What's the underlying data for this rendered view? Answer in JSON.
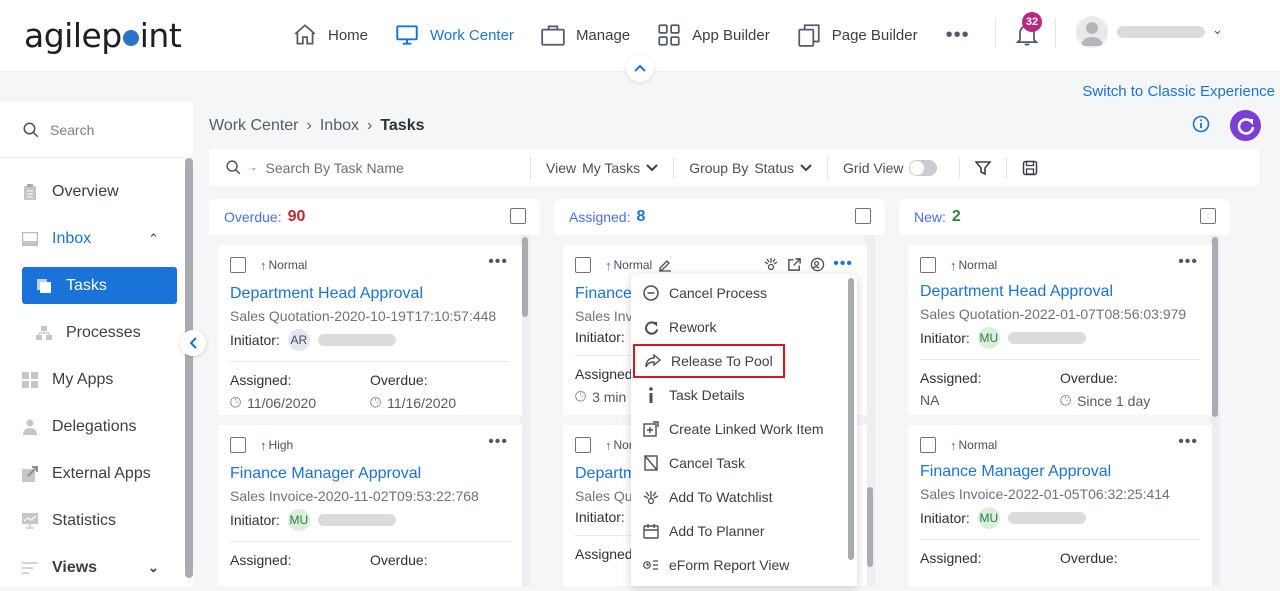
{
  "app": {
    "logo_text_a": "agilep",
    "logo_text_b": "int"
  },
  "nav": {
    "items": [
      {
        "label": "Home",
        "icon": "home-icon"
      },
      {
        "label": "Work Center",
        "icon": "monitor-icon",
        "active": true
      },
      {
        "label": "Manage",
        "icon": "briefcase-icon"
      },
      {
        "label": "App Builder",
        "icon": "grid-icon"
      },
      {
        "label": "Page Builder",
        "icon": "pages-icon"
      }
    ],
    "more_label": "•••",
    "notifications_count": "32"
  },
  "switch_link": "Switch to Classic Experience",
  "sidebar": {
    "search_label": "Search",
    "items": [
      {
        "label": "Overview"
      },
      {
        "label": "Inbox"
      },
      {
        "label": "Tasks"
      },
      {
        "label": "Processes"
      },
      {
        "label": "My Apps"
      },
      {
        "label": "Delegations"
      },
      {
        "label": "External Apps"
      },
      {
        "label": "Statistics"
      },
      {
        "label": "Views"
      }
    ]
  },
  "breadcrumb": {
    "items": [
      "Work Center",
      "Inbox",
      "Tasks"
    ],
    "separator": "›"
  },
  "toolbar": {
    "search_placeholder": "Search By Task Name",
    "view_label": "View",
    "view_value": "My Tasks",
    "group_label": "Group By",
    "group_value": "Status",
    "grid_view_label": "Grid View",
    "grid_view_on": false
  },
  "columns": [
    {
      "label": "Overdue:",
      "count": "90",
      "count_color": "#c0272d",
      "cards": [
        {
          "priority": "Normal",
          "title": "Department Head Approval",
          "ref": "Sales Quotation-2020-10-19T17:10:57:448",
          "initiator_label": "Initiator:",
          "initials": "AR",
          "assigned_label": "Assigned:",
          "assigned": "11/06/2020",
          "overdue_label": "Overdue:",
          "overdue": "11/16/2020"
        },
        {
          "priority": "High",
          "title": "Finance Manager Approval",
          "ref": "Sales Invoice-2020-11-02T09:53:22:768",
          "initiator_label": "Initiator:",
          "initials": "MU",
          "assigned_label": "Assigned:",
          "assigned": "",
          "overdue_label": "Overdue:",
          "overdue": ""
        }
      ]
    },
    {
      "label": "Assigned:",
      "count": "8",
      "count_color": "#1a73d9",
      "cards": [
        {
          "priority": "Normal",
          "title": "Finance Manager Approval",
          "ref": "Sales Invoice",
          "initiator_label": "Initiator:",
          "initials": "",
          "assigned_label": "Assigned:",
          "assigned": "3 min",
          "overdue_label": "",
          "overdue": ""
        },
        {
          "priority": "Normal",
          "title": "Department Head Approval",
          "ref": "Sales Quotation",
          "initiator_label": "Initiator:",
          "initials": "",
          "assigned_label": "Assigned:",
          "assigned": "",
          "overdue_label": "",
          "overdue": ""
        }
      ]
    },
    {
      "label": "New:",
      "count": "2",
      "count_color": "#2e8b3a",
      "cards": [
        {
          "priority": "Normal",
          "title": "Department Head Approval",
          "ref": "Sales Quotation-2022-01-07T08:56:03:979",
          "initiator_label": "Initiator:",
          "initials": "MU",
          "assigned_label": "Assigned:",
          "assigned": "NA",
          "overdue_label": "Overdue:",
          "overdue": "Since 1 day"
        },
        {
          "priority": "Normal",
          "title": "Finance Manager Approval",
          "ref": "Sales Invoice-2022-01-05T06:32:25:414",
          "initiator_label": "Initiator:",
          "initials": "MU",
          "assigned_label": "Assigned:",
          "assigned": "",
          "overdue_label": "Overdue:",
          "overdue": ""
        }
      ]
    }
  ],
  "context_menu": {
    "items": [
      {
        "label": "Cancel Process",
        "icon": "minus-circle-icon"
      },
      {
        "label": "Rework",
        "icon": "redo-icon"
      },
      {
        "label": "Release To Pool",
        "icon": "share-arrow-icon",
        "highlighted": true
      },
      {
        "label": "Task Details",
        "icon": "info-icon"
      },
      {
        "label": "Create Linked Work Item",
        "icon": "linked-item-icon"
      },
      {
        "label": "Cancel Task",
        "icon": "cancel-task-icon"
      },
      {
        "label": "Add To Watchlist",
        "icon": "watch-icon"
      },
      {
        "label": "Add To Planner",
        "icon": "calendar-icon"
      },
      {
        "label": "eForm Report View",
        "icon": "report-icon"
      }
    ]
  },
  "colors": {
    "accent": "#1a73d9",
    "refresh": "#7b3fd6",
    "badge": "#b62a86",
    "highlight_border": "#d3191f"
  }
}
